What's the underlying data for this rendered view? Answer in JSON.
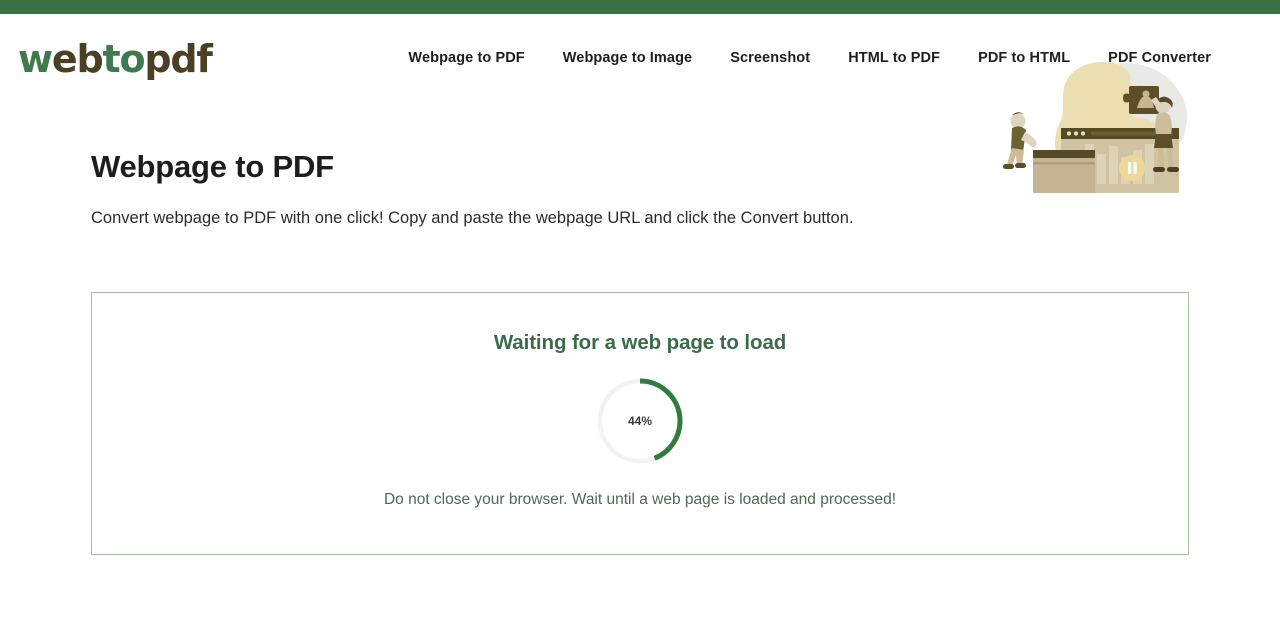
{
  "brand": {
    "logo_part1": "w",
    "logo_part2": "eb",
    "logo_part3": "to",
    "logo_part4": "pdf",
    "accent_green": "#3a7046",
    "logo_dark": "#4b4026"
  },
  "nav": {
    "items": [
      {
        "label": "Webpage to PDF"
      },
      {
        "label": "Webpage to Image"
      },
      {
        "label": "Screenshot"
      },
      {
        "label": "HTML to PDF"
      },
      {
        "label": "PDF to HTML"
      },
      {
        "label": "PDF Converter"
      }
    ]
  },
  "hero": {
    "title": "Webpage to PDF",
    "subtitle": "Convert webpage to PDF with one click! Copy and paste the webpage URL and click the Convert button."
  },
  "progress_panel": {
    "title": "Waiting for a web page to load",
    "percent_label": "44%",
    "percent_value": 44,
    "note": "Do not close your browser. Wait until a web page is loaded and processed!",
    "border_color": "#a9bfa8",
    "arc_color": "#337a3f",
    "track_color": "#f2f2f2",
    "title_color": "#3c6b4b",
    "note_color": "#4e6a52"
  },
  "illustration": {
    "name": "people-assembling-puzzle-browser-illustration",
    "palette": {
      "blob_cream": "#ece0b4",
      "blob_gray": "#e6e6e4",
      "dark_olive": "#544824",
      "mid_tan": "#c9b894",
      "light_tan": "#ded3b7",
      "skin": "#ded4c0",
      "pause_badge": "#edd79a"
    }
  }
}
